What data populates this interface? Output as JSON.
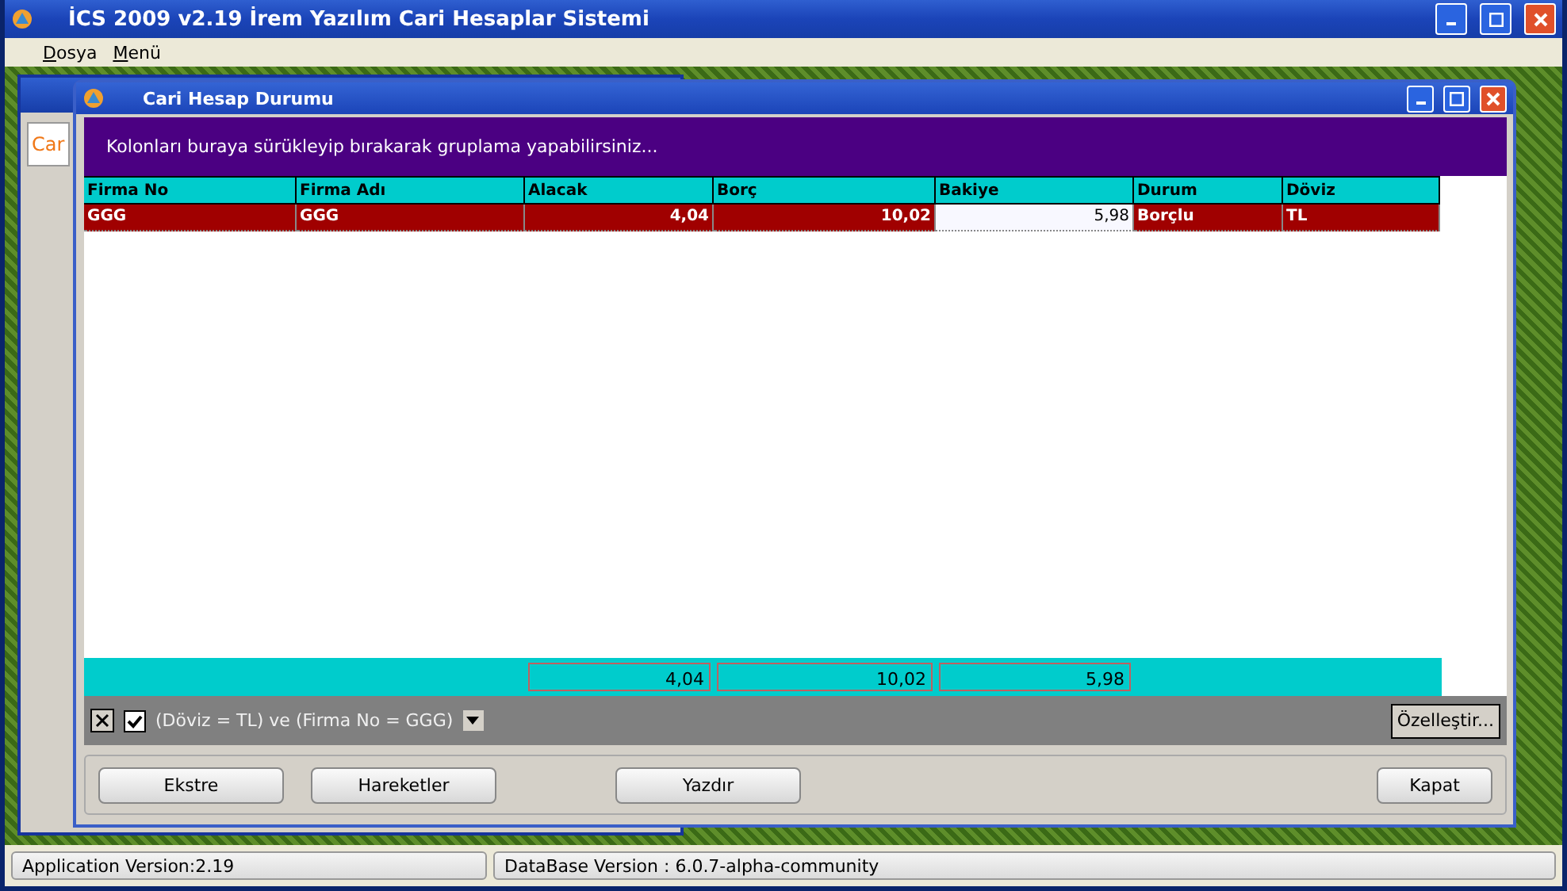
{
  "window": {
    "title": "İCS 2009 v2.19 İrem Yazılım Cari Hesaplar Sistemi"
  },
  "menu": [
    {
      "label": "Dosya"
    },
    {
      "label": "Menü"
    }
  ],
  "back_window": {
    "tab": "Car"
  },
  "child_window": {
    "title": "Cari Hesap Durumu",
    "group_panel": "Kolonları buraya sürükleyip bırakarak gruplama yapabilirsiniz...",
    "columns": [
      "Firma No",
      "Firma Adı",
      "Alacak",
      "Borç",
      "Bakiye",
      "Durum",
      "Döviz"
    ],
    "rows": [
      {
        "selected": true,
        "cells": [
          {
            "text": "GGG",
            "focused": false
          },
          {
            "text": "GGG",
            "focused": false
          },
          {
            "text": "4,04",
            "focused": false
          },
          {
            "text": "10,02",
            "focused": false
          },
          {
            "text": "5,98",
            "focused": true
          },
          {
            "text": "Borçlu",
            "focused": false
          },
          {
            "text": "TL",
            "focused": false
          }
        ]
      }
    ],
    "footer": [
      "4,04",
      "10,02",
      "5,98"
    ],
    "filter": {
      "text": "(Döviz = TL) ve (Firma No = GGG)",
      "active": true
    },
    "customize": "Özelleştir...",
    "buttons": [
      "Ekstre",
      "Hareketler",
      "Yazdır",
      "Kapat"
    ]
  },
  "status_bar": [
    "Application Version:2.19",
    "DataBase Version : 6.0.7-alpha-community"
  ]
}
